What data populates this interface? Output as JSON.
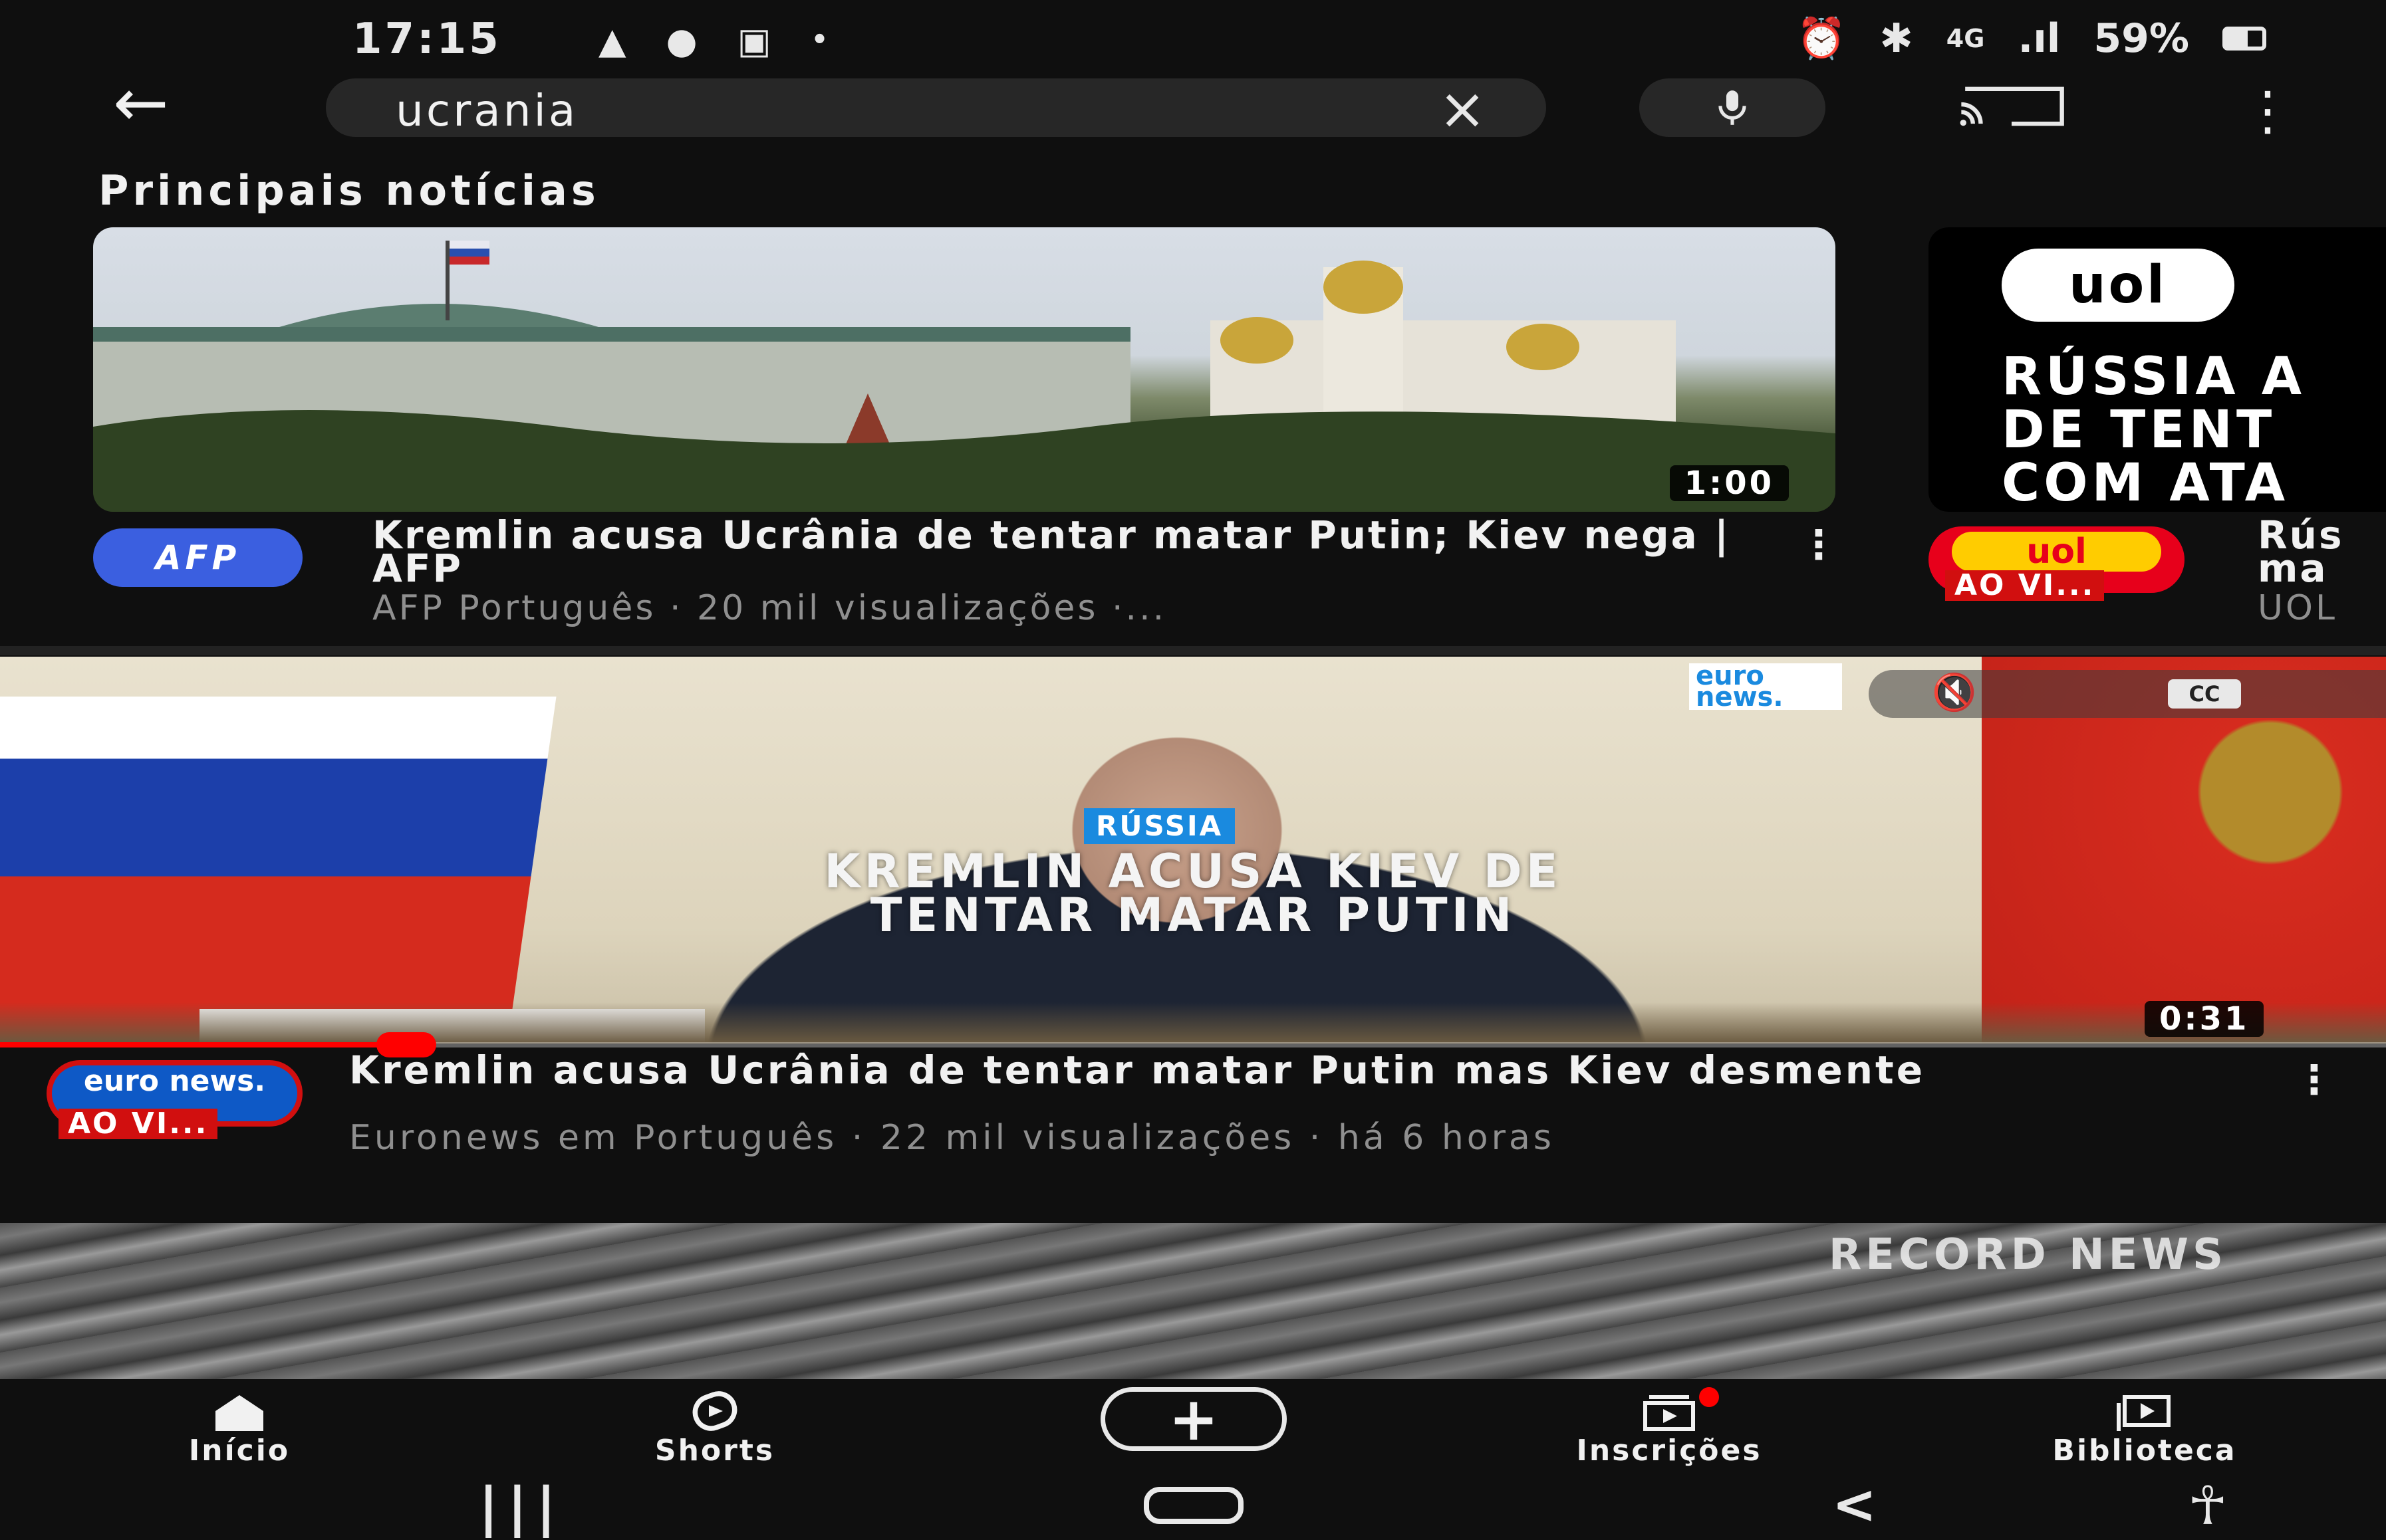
{
  "status_bar": {
    "time": "17:15",
    "battery": "59%",
    "network": "4G"
  },
  "search": {
    "query": "ucrania"
  },
  "section": {
    "title": "Principais notícias"
  },
  "cards": [
    {
      "channel_logo": "AFP",
      "duration": "1:00",
      "title": "Kremlin acusa Ucrânia de tentar matar Putin; Kiev nega | AFP",
      "meta": "AFP Português · 20 mil visualizações ·..."
    },
    {
      "logo": "uol",
      "thumbnail_text": "RÚSSIA A\nDE TENT\nCOM ATA",
      "channel_logo": "uol",
      "live_badge": "AO VI...",
      "title": "Rús\nma",
      "meta": "UOL"
    }
  ],
  "player": {
    "watermark": "euro news.",
    "cc_label": "CC",
    "tag": "RÚSSIA",
    "overlay_line1": "KREMLIN ACUSA KIEV DE",
    "overlay_line2": "TENTAR MATAR PUTIN",
    "duration": "0:31",
    "progress": 0.166
  },
  "video": {
    "channel_logo": "euro news.",
    "live_badge": "AO VI...",
    "title": "Kremlin acusa Ucrânia de tentar matar Putin mas Kiev desmente",
    "meta": "Euronews em Português · 22 mil visualizações · há 6 horas"
  },
  "next_video": {
    "watermark": "RECORD NEWS"
  },
  "bottom_nav": [
    {
      "label": "Início",
      "icon": "home-icon"
    },
    {
      "label": "Shorts",
      "icon": "shorts-icon"
    },
    {
      "label": "",
      "icon": "create-icon"
    },
    {
      "label": "Inscrições",
      "icon": "subscriptions-icon"
    },
    {
      "label": "Biblioteca",
      "icon": "library-icon"
    }
  ],
  "colors": {
    "background": "#0f0f0f",
    "accent_red": "#ff0000",
    "meta_text": "#8f8f8f",
    "afp_blue": "#3b5fe0"
  }
}
